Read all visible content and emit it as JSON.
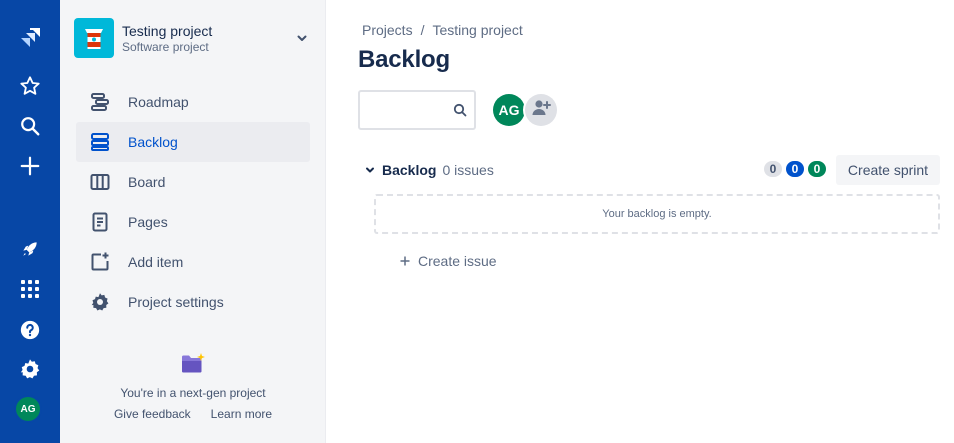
{
  "global_nav": {
    "avatar_initials": "AG",
    "icons": [
      "jira-logo-icon",
      "star-icon",
      "search-icon",
      "plus-icon",
      "rocket-icon",
      "app-switcher-icon",
      "help-icon",
      "settings-icon"
    ]
  },
  "project": {
    "name": "Testing project",
    "type": "Software project"
  },
  "sidebar": {
    "items": [
      {
        "label": "Roadmap",
        "icon": "roadmap-icon"
      },
      {
        "label": "Backlog",
        "icon": "backlog-icon",
        "active": true
      },
      {
        "label": "Board",
        "icon": "board-icon"
      },
      {
        "label": "Pages",
        "icon": "pages-icon"
      },
      {
        "label": "Add item",
        "icon": "add-item-icon"
      },
      {
        "label": "Project settings",
        "icon": "gear-icon"
      }
    ],
    "nextgen": {
      "text": "You're in a next-gen project",
      "feedback_label": "Give feedback",
      "learn_more_label": "Learn more"
    }
  },
  "breadcrumb": {
    "root": "Projects",
    "separator": "/",
    "current": "Testing project"
  },
  "page_title": "Backlog",
  "search": {
    "value": "",
    "placeholder": ""
  },
  "assignees": {
    "avatar_initials": "AG"
  },
  "backlog": {
    "title": "Backlog",
    "issue_count": "0 issues",
    "status_counts": {
      "todo": "0",
      "in_progress": "0",
      "done": "0"
    },
    "create_sprint_label": "Create sprint",
    "empty_message": "Your backlog is empty.",
    "create_issue_label": "Create issue"
  },
  "colors": {
    "global_nav": "#0747a6",
    "accent": "#0052cc",
    "success": "#00875a",
    "sidebar_bg": "#f4f5f7"
  }
}
